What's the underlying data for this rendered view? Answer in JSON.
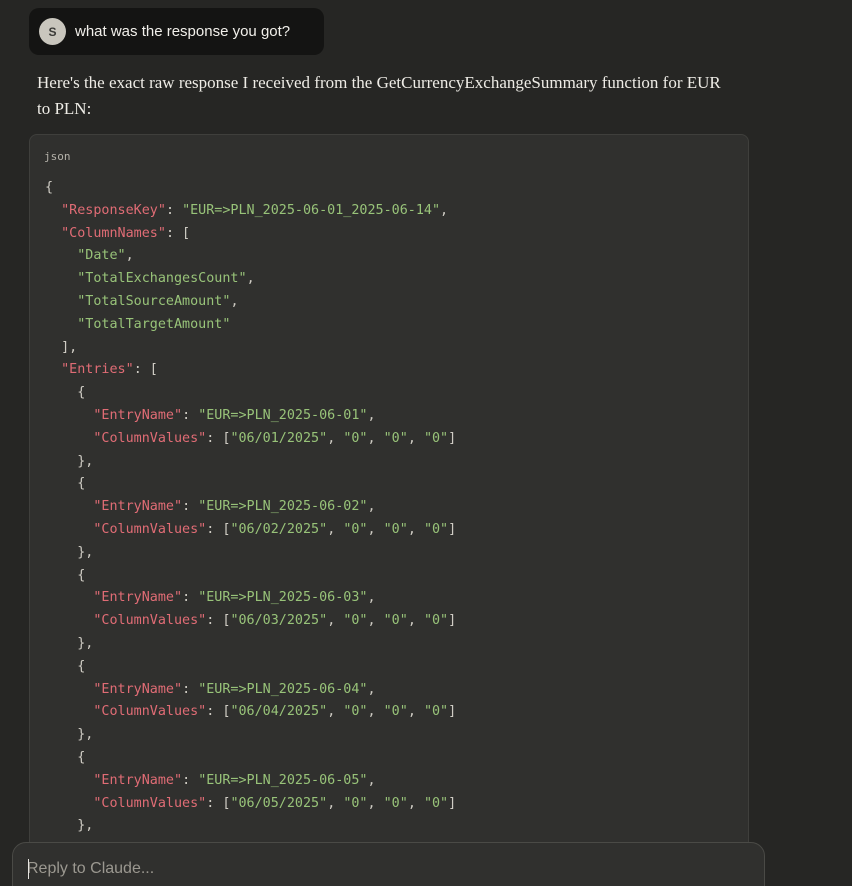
{
  "user_message": {
    "avatar_initial": "S",
    "text": "what was the response you got?"
  },
  "assistant": {
    "intro_text": "Here's the exact raw response I received from the GetCurrencyExchangeSummary function for EUR to PLN:",
    "code_language": "json",
    "code": {
      "response_key_label": "\"ResponseKey\"",
      "response_key_value": "\"EUR=>PLN_2025-06-01_2025-06-14\"",
      "column_names_label": "\"ColumnNames\"",
      "column_names": [
        "\"Date\"",
        "\"TotalExchangesCount\"",
        "\"TotalSourceAmount\"",
        "\"TotalTargetAmount\""
      ],
      "entries_label": "\"Entries\"",
      "entry_name_label": "\"EntryName\"",
      "column_values_label": "\"ColumnValues\"",
      "entries": [
        {
          "name": "\"EUR=>PLN_2025-06-01\"",
          "values": [
            "\"06/01/2025\"",
            "\"0\"",
            "\"0\"",
            "\"0\""
          ]
        },
        {
          "name": "\"EUR=>PLN_2025-06-02\"",
          "values": [
            "\"06/02/2025\"",
            "\"0\"",
            "\"0\"",
            "\"0\""
          ]
        },
        {
          "name": "\"EUR=>PLN_2025-06-03\"",
          "values": [
            "\"06/03/2025\"",
            "\"0\"",
            "\"0\"",
            "\"0\""
          ]
        },
        {
          "name": "\"EUR=>PLN_2025-06-04\"",
          "values": [
            "\"06/04/2025\"",
            "\"0\"",
            "\"0\"",
            "\"0\""
          ]
        },
        {
          "name": "\"EUR=>PLN_2025-06-05\"",
          "values": [
            "\"06/05/2025\"",
            "\"0\"",
            "\"0\"",
            "\"0\""
          ]
        }
      ]
    }
  },
  "reply": {
    "placeholder": "Reply to Claude..."
  },
  "colors": {
    "background": "#262624",
    "code_key": "#e06c75",
    "code_string": "#98c379"
  }
}
